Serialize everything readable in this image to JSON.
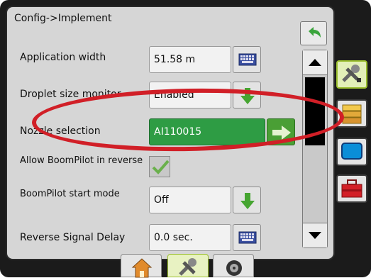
{
  "title": "Config->Implement",
  "rows": [
    {
      "label": "Application width",
      "value": "51.58 m",
      "action_icon": "keyboard-icon"
    },
    {
      "label": "Droplet size monitor",
      "value": "Enabled",
      "action_icon": "down-arrow-icon"
    },
    {
      "label": "Nozzle selection",
      "value": "AI110015",
      "action_icon": "right-arrow-icon"
    },
    {
      "label": "Allow BoomPilot in reverse",
      "value": "checked",
      "action_icon": "checkbox-icon"
    },
    {
      "label": "BoomPilot start mode",
      "value": "Off",
      "action_icon": "down-arrow-icon"
    },
    {
      "label": "Reverse Signal Delay",
      "value": "0.0 sec.",
      "action_icon": "keyboard-icon"
    }
  ],
  "side_tabs": [
    "tools-icon",
    "drawer-icon",
    "display-icon",
    "toolbox-icon"
  ],
  "bottom_tabs": [
    "home-icon",
    "tools-icon",
    "speaker-icon"
  ],
  "colors": {
    "accent_green": "#2e9c44",
    "highlight_red": "#d11f27",
    "active_tab": "#9bbf2e"
  }
}
